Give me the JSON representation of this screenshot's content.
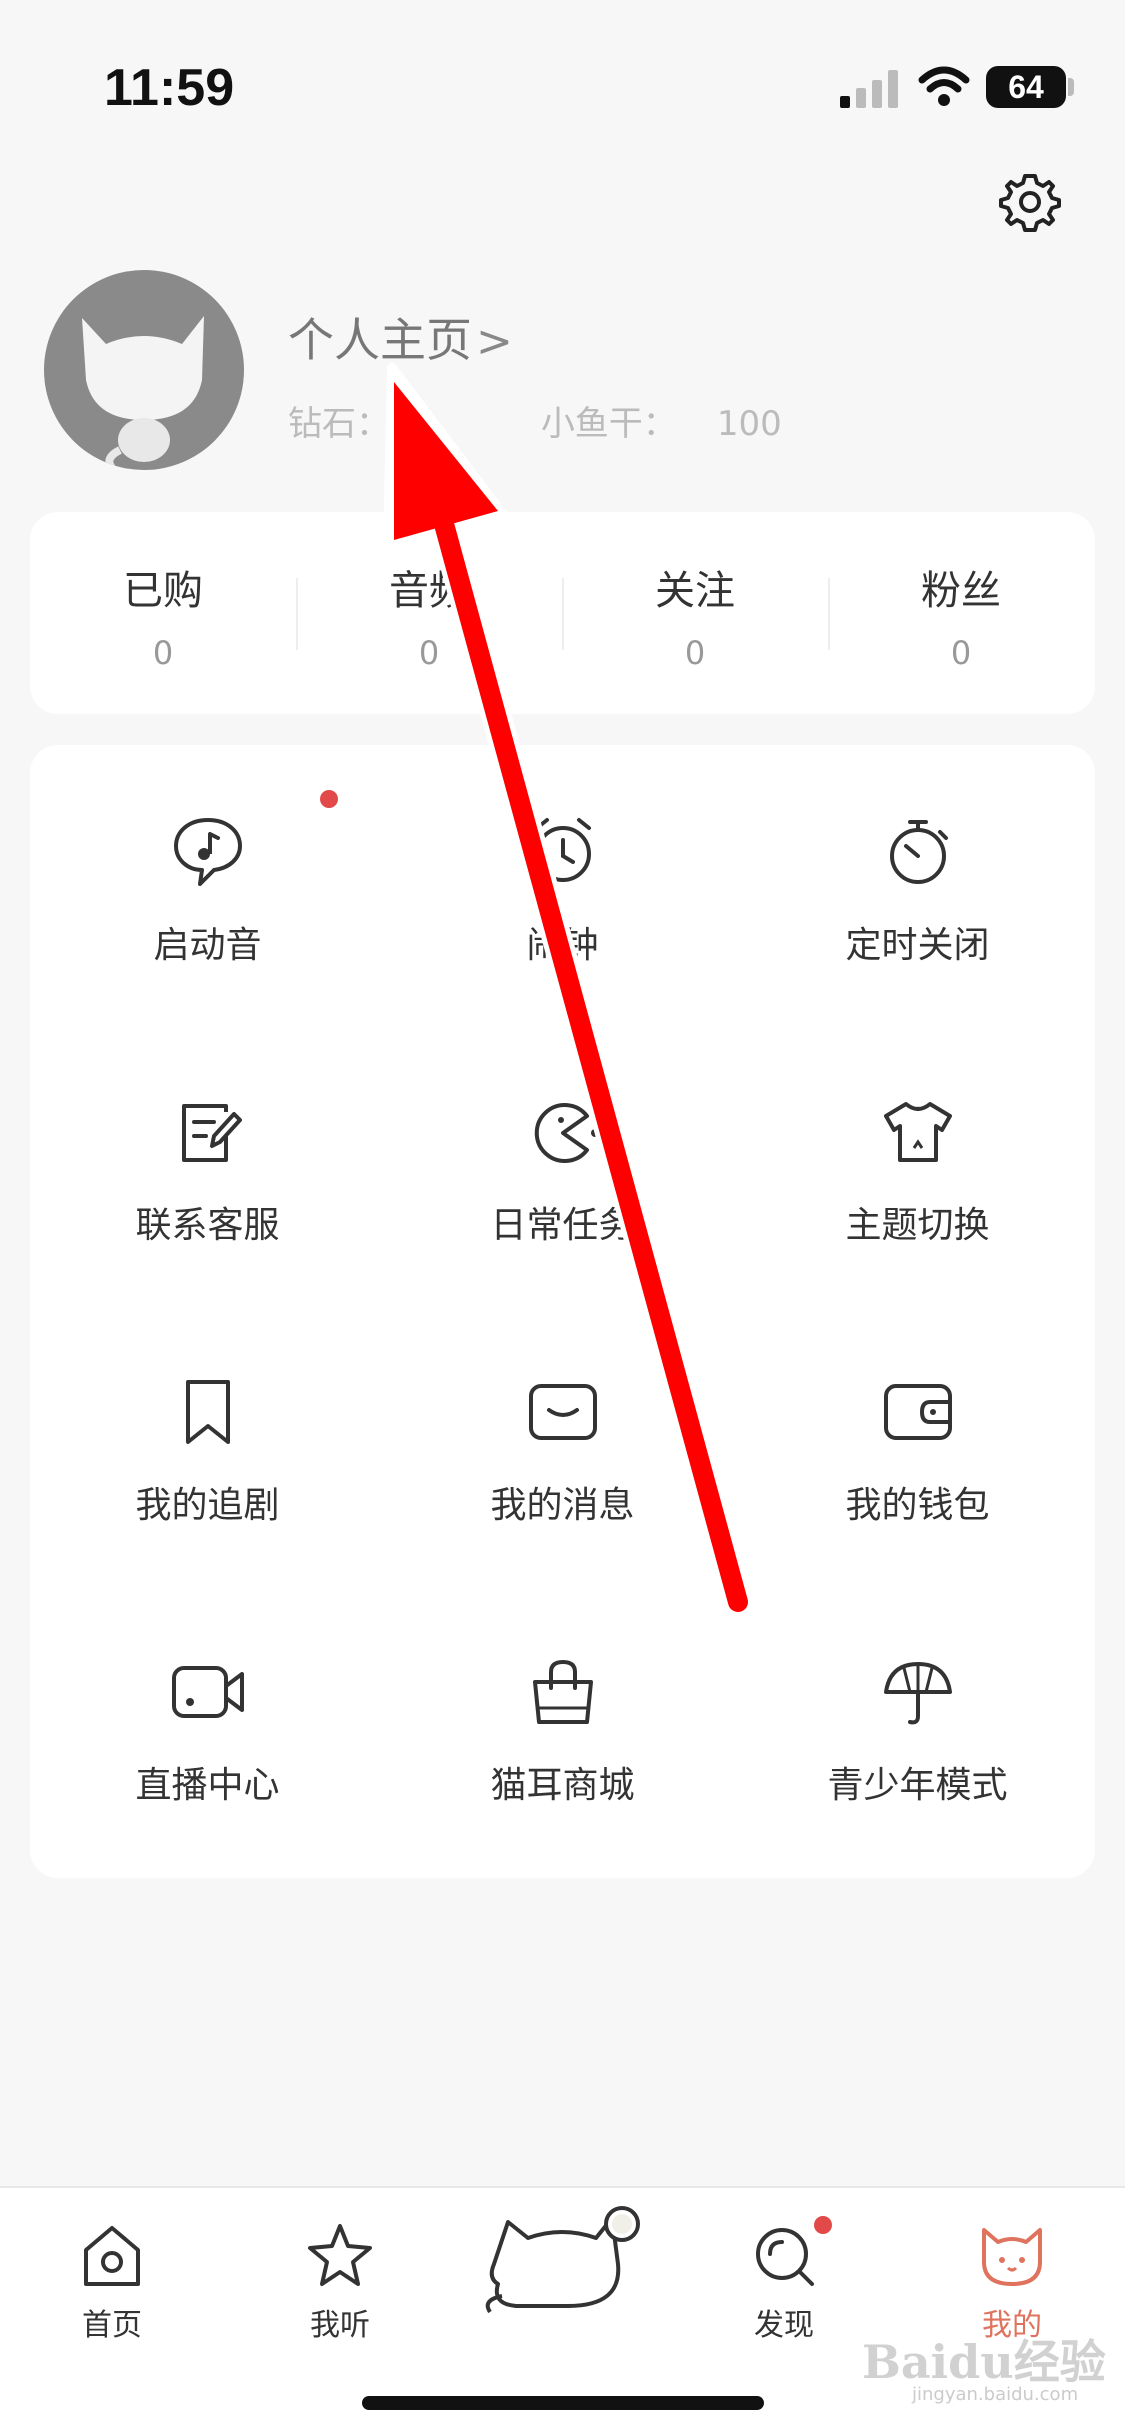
{
  "status": {
    "time": "11:59",
    "battery": "64"
  },
  "profile": {
    "link_label": "个人主页",
    "chevron": ">",
    "diamond_label": "钻石：",
    "fish_label": "小鱼干：",
    "fish_value": "100"
  },
  "stats": [
    {
      "label": "已购",
      "value": "0"
    },
    {
      "label": "音频",
      "value": "0"
    },
    {
      "label": "关注",
      "value": "0"
    },
    {
      "label": "粉丝",
      "value": "0"
    }
  ],
  "grid": [
    {
      "label": "启动音",
      "icon": "music-bubble-icon"
    },
    {
      "label": "闹钟",
      "icon": "alarm-clock-icon"
    },
    {
      "label": "定时关闭",
      "icon": "stopwatch-icon"
    },
    {
      "label": "联系客服",
      "icon": "edit-note-icon"
    },
    {
      "label": "日常任务",
      "icon": "pacman-icon"
    },
    {
      "label": "主题切换",
      "icon": "tshirt-icon"
    },
    {
      "label": "我的追剧",
      "icon": "bookmark-icon"
    },
    {
      "label": "我的消息",
      "icon": "envelope-icon"
    },
    {
      "label": "我的钱包",
      "icon": "wallet-icon"
    },
    {
      "label": "直播中心",
      "icon": "video-camera-icon"
    },
    {
      "label": "猫耳商城",
      "icon": "shopping-bag-icon"
    },
    {
      "label": "青少年模式",
      "icon": "umbrella-icon"
    }
  ],
  "tabs": [
    {
      "label": "首页",
      "icon": "home-icon"
    },
    {
      "label": "我听",
      "icon": "star-icon"
    },
    {
      "label": "",
      "icon": "cat-center-icon"
    },
    {
      "label": "发现",
      "icon": "discover-icon"
    },
    {
      "label": "我的",
      "icon": "cat-face-icon"
    }
  ],
  "colors": {
    "accent": "#e0735e",
    "reddot": "#e24a4a",
    "arrow": "#ff0000"
  },
  "watermark": {
    "text": "Baidu经验",
    "sub": "jingyan.baidu.com"
  }
}
